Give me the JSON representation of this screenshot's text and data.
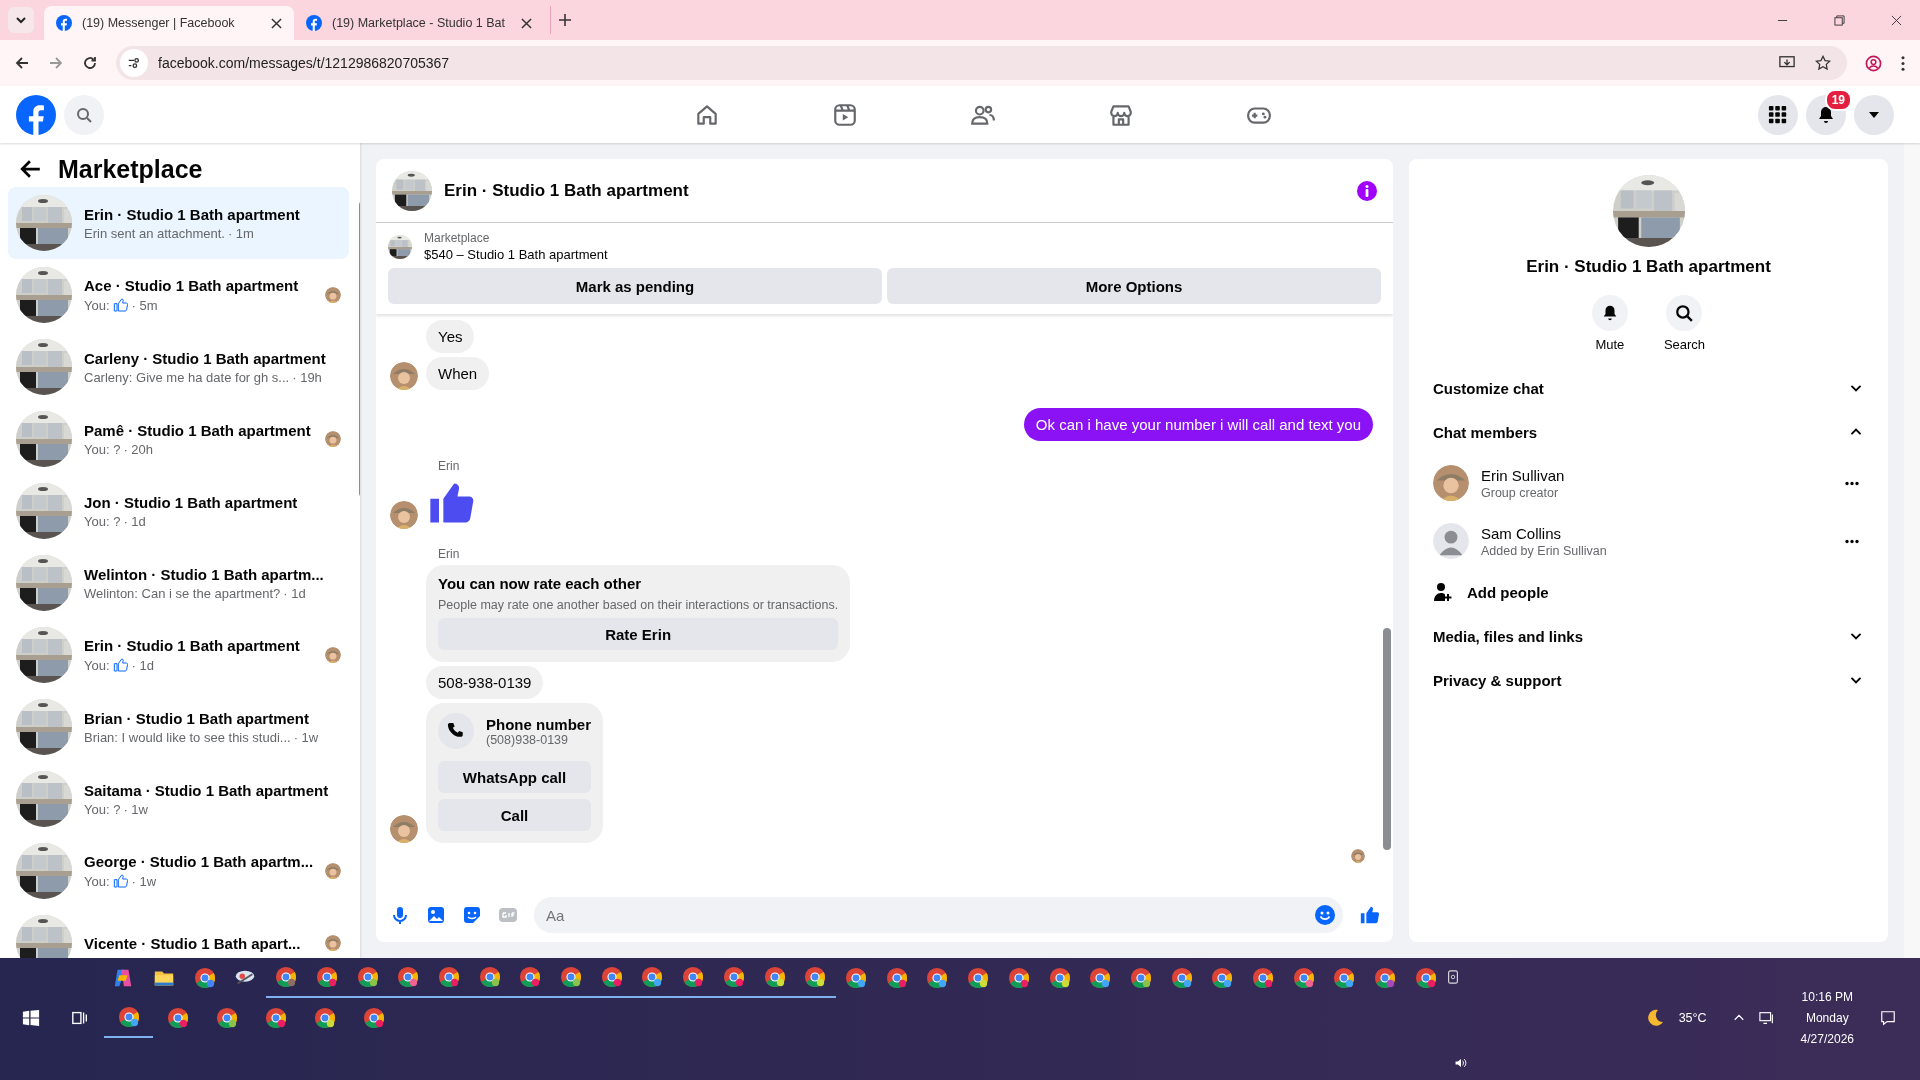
{
  "browser": {
    "tabs": [
      {
        "title": "(19) Messenger | Facebook",
        "selected": true
      },
      {
        "title": "(19) Marketplace - Studio 1 Bat",
        "selected": false
      }
    ],
    "url": "facebook.com/messages/t/1212986820705367"
  },
  "topbar": {
    "notification_count": "19"
  },
  "sidebar": {
    "title": "Marketplace",
    "conversations": [
      {
        "title": "Erin · Studio 1 Bath apartment",
        "preview": "Erin sent an attachment.",
        "liked": false,
        "time": "· 1m",
        "selected": true,
        "receipt": false
      },
      {
        "title": "Ace · Studio 1 Bath apartment",
        "preview": "You:",
        "liked": true,
        "time": "· 5m",
        "selected": false,
        "receipt": true
      },
      {
        "title": "Carleny · Studio 1 Bath apartment",
        "preview": "Carleny: Give me ha date for gh s...",
        "liked": false,
        "time": "· 19h",
        "selected": false,
        "receipt": false
      },
      {
        "title": "Pamê · Studio 1 Bath apartment",
        "preview": "You: ?",
        "liked": false,
        "time": "· 20h",
        "selected": false,
        "receipt": true
      },
      {
        "title": "Jon · Studio 1 Bath apartment",
        "preview": "You: ?",
        "liked": false,
        "time": "· 1d",
        "selected": false,
        "receipt": false
      },
      {
        "title": "Welinton · Studio 1 Bath apartm...",
        "preview": "Welinton: Can i se the apartment?",
        "liked": false,
        "time": "· 1d",
        "selected": false,
        "receipt": false
      },
      {
        "title": "Erin · Studio 1 Bath apartment",
        "preview": "You:",
        "liked": true,
        "time": "· 1d",
        "selected": false,
        "receipt": true
      },
      {
        "title": "Brian · Studio 1 Bath apartment",
        "preview": "Brian: I would like to see this studi...",
        "liked": false,
        "time": "· 1w",
        "selected": false,
        "receipt": false
      },
      {
        "title": "Saitama · Studio 1 Bath apartment",
        "preview": "You: ?",
        "liked": false,
        "time": "· 1w",
        "selected": false,
        "receipt": false
      },
      {
        "title": "George · Studio 1 Bath apartm...",
        "preview": "You:",
        "liked": true,
        "time": "· 1w",
        "selected": false,
        "receipt": true
      },
      {
        "title": "Vicente · Studio 1 Bath apart...",
        "selected": false,
        "receipt": true
      }
    ]
  },
  "chat": {
    "title": "Erin · Studio 1 Bath apartment",
    "listing": {
      "label": "Marketplace",
      "price_title": "$540 – Studio 1 Bath apartment"
    },
    "actions": [
      "Mark as pending",
      "More Options"
    ],
    "groups": [
      {
        "outgoing": false,
        "avatar": true,
        "items": [
          {
            "kind": "text",
            "text": "Yes"
          },
          {
            "kind": "text",
            "text": "When"
          }
        ]
      },
      {
        "outgoing": true,
        "avatar": false,
        "items": [
          {
            "kind": "text",
            "text": "Ok can i have your number i will call and text you"
          }
        ]
      },
      {
        "outgoing": false,
        "sender": "Erin",
        "avatar": true,
        "items": [
          {
            "kind": "like"
          }
        ]
      },
      {
        "outgoing": false,
        "sender": "Erin",
        "avatar": true,
        "items": [
          {
            "kind": "rate_card",
            "title": "You can now rate each other",
            "body": "People may rate one another based on their interactions or transactions.",
            "button": "Rate Erin"
          },
          {
            "kind": "text",
            "text": "508-938-0139"
          },
          {
            "kind": "phone_card",
            "title": "Phone number",
            "number": "(508)938-0139",
            "buttons": [
              "WhatsApp call",
              "Call"
            ]
          }
        ]
      }
    ],
    "seen": true,
    "composer": {
      "placeholder": "Aa"
    }
  },
  "details": {
    "title": "Erin · Studio 1 Bath apartment",
    "actions": [
      {
        "kind": "mute",
        "label": "Mute"
      },
      {
        "kind": "search",
        "label": "Search"
      }
    ],
    "sections": [
      {
        "label": "Customize chat",
        "expanded": false
      },
      {
        "label": "Chat members",
        "expanded": true,
        "members": [
          {
            "name": "Erin Sullivan",
            "role": "Group creator",
            "has_photo": true
          },
          {
            "name": "Sam Collins",
            "role": "Added by Erin Sullivan",
            "has_photo": false
          }
        ],
        "add_label": "Add people"
      },
      {
        "label": "Media, files and links",
        "expanded": false
      },
      {
        "label": "Privacy & support",
        "expanded": false
      }
    ]
  },
  "taskbar": {
    "weather": "35°C",
    "time": "10:16 PM",
    "day": "Monday",
    "date": "4/27/2026"
  }
}
